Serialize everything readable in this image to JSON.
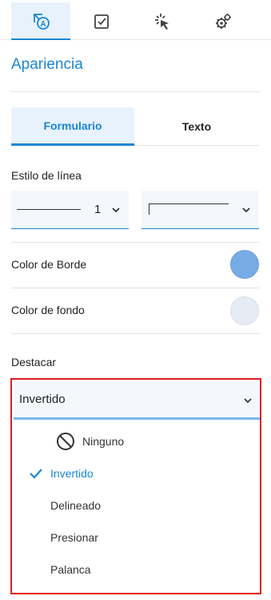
{
  "top_tabs": [
    {
      "name": "appearance",
      "icon": "appearance-icon",
      "active": true
    },
    {
      "name": "checkbox",
      "icon": "checkbox-icon",
      "active": false
    },
    {
      "name": "interaction",
      "icon": "click-icon",
      "active": false
    },
    {
      "name": "settings",
      "icon": "gears-icon",
      "active": false
    }
  ],
  "section": {
    "title": "Apariencia"
  },
  "segmented": {
    "form_label": "Formulario",
    "text_label": "Texto"
  },
  "line_style": {
    "label": "Estilo de línea",
    "width_value": "1"
  },
  "border_color": {
    "label": "Color de Borde",
    "color": "#77abe6"
  },
  "fill_color": {
    "label": "Color de fondo",
    "color": "#e6ecf4"
  },
  "highlight": {
    "label": "Destacar",
    "selected": "Invertido",
    "options": [
      {
        "label": "Ninguno",
        "icon": "ban-icon",
        "selected": false
      },
      {
        "label": "Invertido",
        "icon": "check-icon",
        "selected": true
      },
      {
        "label": "Delineado",
        "selected": false
      },
      {
        "label": "Presionar",
        "selected": false
      },
      {
        "label": "Palanca",
        "selected": false
      }
    ]
  },
  "colors": {
    "accent": "#1a86d6",
    "accent_bg": "#e8f2fc",
    "annotation_red": "#e01b24"
  }
}
